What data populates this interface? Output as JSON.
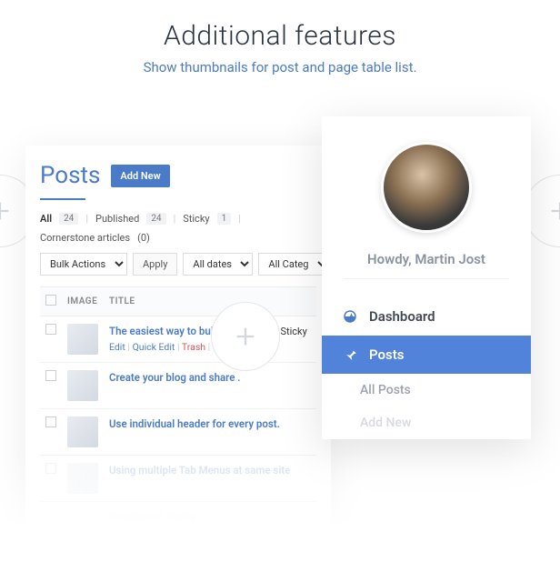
{
  "header": {
    "title": "Additional features",
    "subtitle": "Show thumbnails for post and page table list."
  },
  "posts": {
    "heading": "Posts",
    "add_new": "Add New",
    "filters": {
      "all": "All",
      "all_count": "24",
      "published": "Published",
      "published_count": "24",
      "sticky": "Sticky",
      "sticky_count": "1",
      "cornerstone": "Cornerstone articles",
      "cornerstone_count": "(0)"
    },
    "bulk": "Bulk Actions",
    "apply": "Apply",
    "dates": "All dates",
    "cats": "All Categ",
    "cols": {
      "image": "IMAGE",
      "title": "TITLE"
    },
    "rows": [
      {
        "title": "The easiest way to build presence",
        "sticky": " — Sticky",
        "actions": {
          "edit": "Edit",
          "quick": "Quick Edit",
          "trash": "Trash"
        }
      },
      {
        "title": "Create your blog and share ."
      },
      {
        "title": "Use individual header for every post."
      },
      {
        "title": "Using multiple Tab Menus at same site"
      },
      {
        "title": "Postformat: Quote"
      }
    ]
  },
  "menu": {
    "howdy": "Howdy, Martin Jost",
    "dashboard": "Dashboard",
    "posts": "Posts",
    "all_posts": "All Posts",
    "add_new": "Add New"
  }
}
